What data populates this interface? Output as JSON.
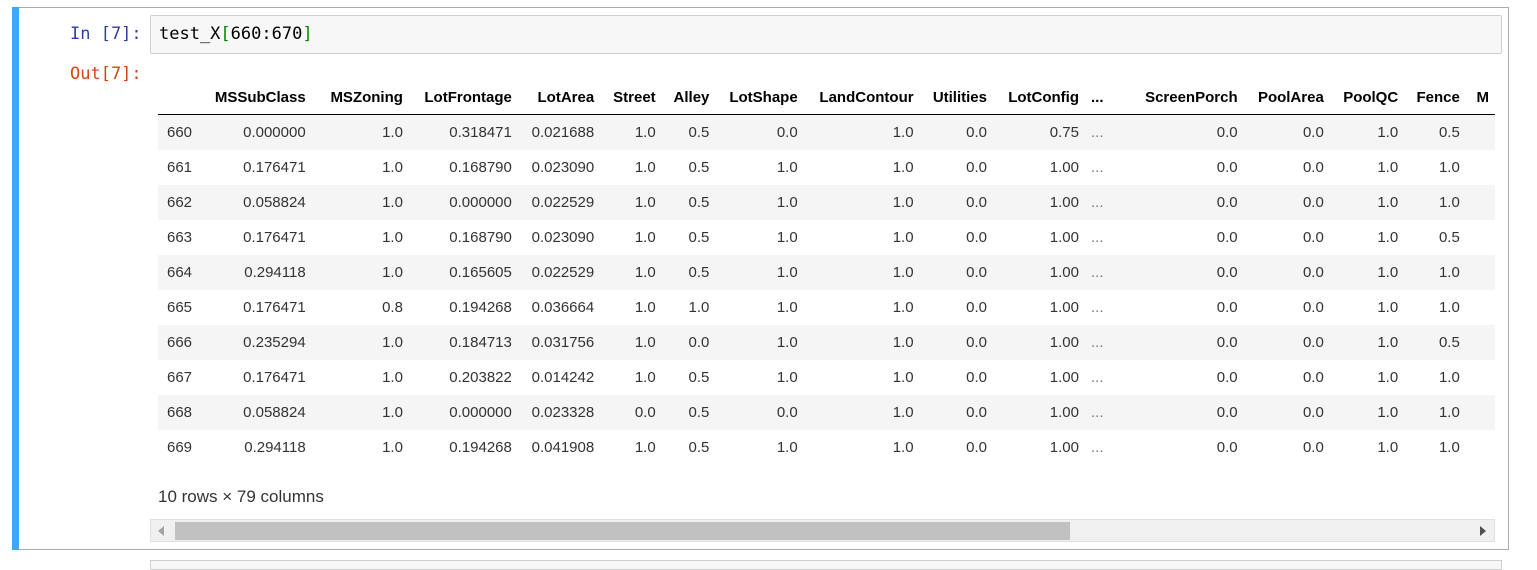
{
  "cell": {
    "in_prompt": "In [7]:",
    "out_prompt": "Out[7]:",
    "code": {
      "var": "test_X",
      "open": "[",
      "slice": "660:670",
      "close": "]"
    }
  },
  "table": {
    "columns": [
      "",
      "MSSubClass",
      "MSZoning",
      "LotFrontage",
      "LotArea",
      "Street",
      "Alley",
      "LotShape",
      "LandContour",
      "Utilities",
      "LotConfig",
      "...",
      "ScreenPorch",
      "PoolArea",
      "PoolQC",
      "Fence",
      "M"
    ],
    "rows": [
      [
        "660",
        "0.000000",
        "1.0",
        "0.318471",
        "0.021688",
        "1.0",
        "0.5",
        "0.0",
        "1.0",
        "0.0",
        "0.75",
        "...",
        "0.0",
        "0.0",
        "1.0",
        "0.5"
      ],
      [
        "661",
        "0.176471",
        "1.0",
        "0.168790",
        "0.023090",
        "1.0",
        "0.5",
        "1.0",
        "1.0",
        "0.0",
        "1.00",
        "...",
        "0.0",
        "0.0",
        "1.0",
        "1.0"
      ],
      [
        "662",
        "0.058824",
        "1.0",
        "0.000000",
        "0.022529",
        "1.0",
        "0.5",
        "1.0",
        "1.0",
        "0.0",
        "1.00",
        "...",
        "0.0",
        "0.0",
        "1.0",
        "1.0"
      ],
      [
        "663",
        "0.176471",
        "1.0",
        "0.168790",
        "0.023090",
        "1.0",
        "0.5",
        "1.0",
        "1.0",
        "0.0",
        "1.00",
        "...",
        "0.0",
        "0.0",
        "1.0",
        "0.5"
      ],
      [
        "664",
        "0.294118",
        "1.0",
        "0.165605",
        "0.022529",
        "1.0",
        "0.5",
        "1.0",
        "1.0",
        "0.0",
        "1.00",
        "...",
        "0.0",
        "0.0",
        "1.0",
        "1.0"
      ],
      [
        "665",
        "0.176471",
        "0.8",
        "0.194268",
        "0.036664",
        "1.0",
        "1.0",
        "1.0",
        "1.0",
        "0.0",
        "1.00",
        "...",
        "0.0",
        "0.0",
        "1.0",
        "1.0"
      ],
      [
        "666",
        "0.235294",
        "1.0",
        "0.184713",
        "0.031756",
        "1.0",
        "0.0",
        "1.0",
        "1.0",
        "0.0",
        "1.00",
        "...",
        "0.0",
        "0.0",
        "1.0",
        "0.5"
      ],
      [
        "667",
        "0.176471",
        "1.0",
        "0.203822",
        "0.014242",
        "1.0",
        "0.5",
        "1.0",
        "1.0",
        "0.0",
        "1.00",
        "...",
        "0.0",
        "0.0",
        "1.0",
        "1.0"
      ],
      [
        "668",
        "0.058824",
        "1.0",
        "0.000000",
        "0.023328",
        "0.0",
        "0.5",
        "0.0",
        "1.0",
        "0.0",
        "1.00",
        "...",
        "0.0",
        "0.0",
        "1.0",
        "1.0"
      ],
      [
        "669",
        "0.294118",
        "1.0",
        "0.194268",
        "0.041908",
        "1.0",
        "0.5",
        "1.0",
        "1.0",
        "0.0",
        "1.00",
        "...",
        "0.0",
        "0.0",
        "1.0",
        "1.0"
      ]
    ],
    "summary": "10 rows × 79 columns"
  },
  "scrollbar": {
    "position_fraction": 0.0,
    "visible_fraction": 0.69
  },
  "colors": {
    "cell_bar": "#42a5f5",
    "in_prompt": "#303f9f",
    "out_prompt": "#d84315",
    "bracket": "#008800"
  }
}
